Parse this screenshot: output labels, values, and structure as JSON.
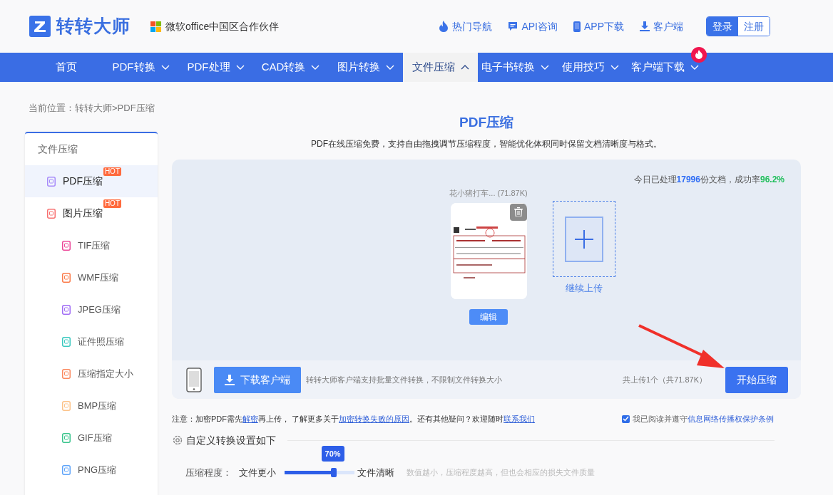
{
  "logo": {
    "text": "转转大师"
  },
  "partner": "微软office中国区合作伙伴",
  "top_links": [
    {
      "label": "热门导航",
      "kind": "fire"
    },
    {
      "label": "API咨询",
      "kind": "chat"
    },
    {
      "label": "APP下载",
      "kind": "phone"
    },
    {
      "label": "客户端",
      "kind": "download"
    }
  ],
  "auth_buttons": [
    {
      "label": "登录",
      "selected": true
    },
    {
      "label": "注册",
      "selected": false
    }
  ],
  "nav": [
    {
      "label": "首页",
      "has_menu": false,
      "selected": false,
      "hot": false
    },
    {
      "label": "PDF转换",
      "has_menu": true,
      "expanded": false,
      "selected": false,
      "hot": false
    },
    {
      "label": "PDF处理",
      "has_menu": true,
      "expanded": false,
      "selected": false,
      "hot": false
    },
    {
      "label": "CAD转换",
      "has_menu": true,
      "expanded": false,
      "selected": false,
      "hot": false
    },
    {
      "label": "图片转换",
      "has_menu": true,
      "expanded": false,
      "selected": false,
      "hot": false
    },
    {
      "label": "文件压缩",
      "has_menu": true,
      "expanded": true,
      "selected": true,
      "hot": false
    },
    {
      "label": "电子书转换",
      "has_menu": true,
      "expanded": false,
      "selected": false,
      "hot": false
    },
    {
      "label": "使用技巧",
      "has_menu": true,
      "expanded": false,
      "selected": false,
      "hot": false
    },
    {
      "label": "客户端下载",
      "has_menu": true,
      "expanded": false,
      "selected": false,
      "hot": true
    }
  ],
  "breadcrumb": "当前位置：转转大师>PDF压缩",
  "sidebar": {
    "heading": "文件压缩",
    "items": [
      {
        "label": "PDF压缩",
        "selected": true,
        "badge": "HOT",
        "color": "#a78bfa"
      },
      {
        "label": "图片压缩",
        "selected": false,
        "badge": "HOT",
        "color": "#f87171",
        "children": [
          {
            "label": "TIF压缩",
            "selected": false,
            "color": "#ec4899"
          },
          {
            "label": "WMF压缩",
            "selected": false,
            "color": "#fb7c4b"
          },
          {
            "label": "JPEG压缩",
            "selected": false,
            "color": "#a16ef5"
          },
          {
            "label": "证件照压缩",
            "selected": false,
            "color": "#3cc9c0"
          },
          {
            "label": "压缩指定大小",
            "selected": false,
            "color": "#fb8a60"
          },
          {
            "label": "BMP压缩",
            "selected": false,
            "color": "#fcc38a"
          },
          {
            "label": "GIF压缩",
            "selected": false,
            "color": "#3cc58e"
          },
          {
            "label": "PNG压缩",
            "selected": false,
            "color": "#60a5fa"
          }
        ]
      }
    ]
  },
  "page_title": "PDF压缩",
  "subtitle": "PDF在线压缩免费，支持自由拖拽调节压缩程度，智能优化体积同时保留文档清晰度与格式。",
  "upload": {
    "stats": [
      {
        "text": "今日已处理",
        "kind": "plain"
      },
      {
        "text": "17996",
        "kind": "blue"
      },
      {
        "text": "份文档，成功率",
        "kind": "plain"
      },
      {
        "text": "96.2%",
        "kind": "green"
      }
    ],
    "file": {
      "name": "花小猪打车... (71.87K)",
      "edit_button": "编辑",
      "kind": "picture"
    },
    "add_more": "继续上传",
    "download_button": "下载客户端",
    "client_note": "转转大师客户端支持批量文件转换，不限制文件转换大小",
    "summary": "共上传1个（共71.87K）",
    "start_button": "开始压缩"
  },
  "notice": [
    {
      "text": "注意：加密PDF需先",
      "kind": "text"
    },
    {
      "text": "解密",
      "kind": "link"
    },
    {
      "text": "再上传， 了解更多关于",
      "kind": "text"
    },
    {
      "text": "加密转换失败的原因",
      "kind": "link"
    },
    {
      "text": "。还有其他疑问？欢迎随时",
      "kind": "text"
    },
    {
      "text": "联系我们",
      "kind": "link"
    }
  ],
  "agreement": {
    "checked": true,
    "parts": [
      {
        "text": "我已阅读并遵守",
        "kind": "text"
      },
      {
        "text": "信息网络传播权保护条例",
        "kind": "link"
      }
    ]
  },
  "settings": {
    "heading": "自定义转换设置如下",
    "label": "压缩程度：",
    "min_label": "文件更小",
    "max_label": "文件清晰",
    "level": 0.7,
    "tooltip": "70%",
    "hint": "数值越小，压缩程度越高，但也会相应的损失文件质量"
  }
}
